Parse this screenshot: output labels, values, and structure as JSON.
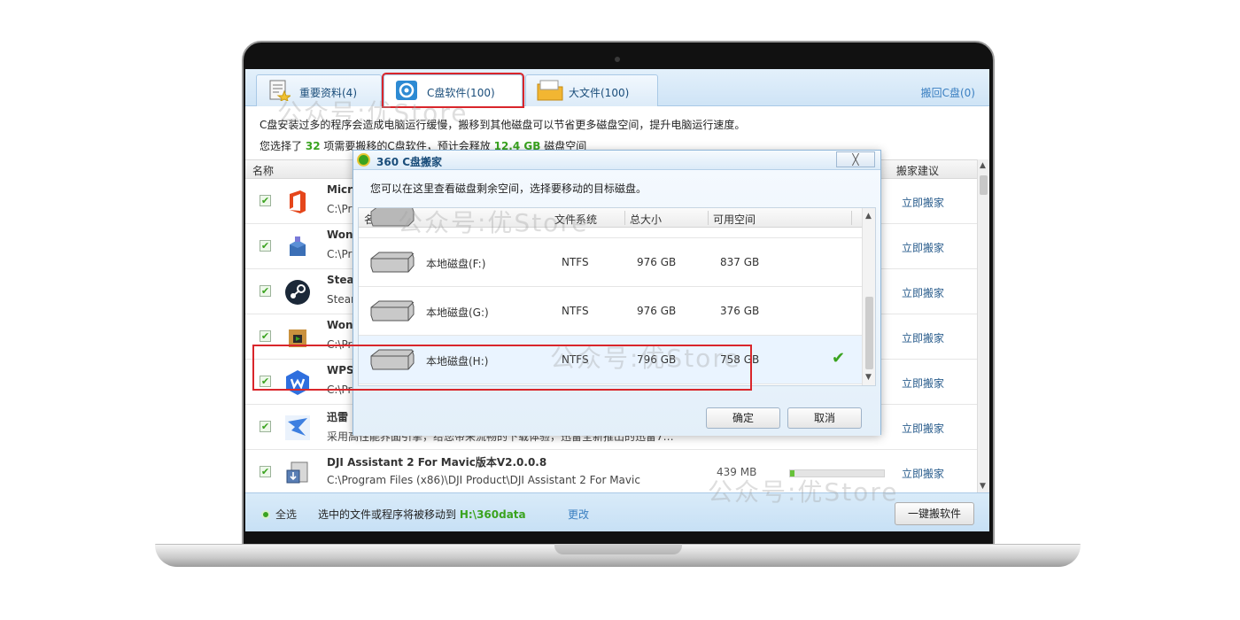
{
  "tabs": [
    {
      "label": "重要资料(4)",
      "icon": "document-star-icon"
    },
    {
      "label": "C盘软件(100)",
      "icon": "disk-c-icon"
    },
    {
      "label": "大文件(100)",
      "icon": "folder-icon"
    }
  ],
  "restore_link": "搬回C盘(0)",
  "description": "C盘安装过多的程序会造成电脑运行缓慢，搬移到其他磁盘可以节省更多磁盘空间，提升电脑运行速度。",
  "summary": {
    "prefix": "您选择了",
    "count": "32",
    "middle": "项需要搬移的C盘软件，预计会释放",
    "size": "12.4 GB",
    "suffix": "磁盘空间"
  },
  "list": {
    "header_name": "名称",
    "header_advice": "搬家建议",
    "rows": [
      {
        "name": "Micro",
        "path": "C:\\Pr",
        "action": "立即搬家",
        "icon": "office-icon"
      },
      {
        "name": "Won",
        "path": "C:\\Pr",
        "action": "立即搬家",
        "icon": "box-icon"
      },
      {
        "name": "Stea",
        "path": "Stear",
        "action": "立即搬家",
        "icon": "steam-icon"
      },
      {
        "name": "Won",
        "path": "C:\\Pr",
        "action": "立即搬家",
        "icon": "package-icon"
      },
      {
        "name": "WPS",
        "path": "C:\\Pr",
        "action": "立即搬家",
        "icon": "wps-icon"
      },
      {
        "name": "迅雷",
        "path": "采用高性能界面引擎，给您带来流畅的下载体验，迅雷全新推出的迅雷7…",
        "action": "立即搬家",
        "icon": "xunlei-icon"
      },
      {
        "name": "DJI Assistant 2 For Mavic版本V2.0.0.8",
        "path": "C:\\Program Files (x86)\\DJI Product\\DJI Assistant 2 For Mavic",
        "size": "439 MB",
        "bar_fraction": 0.05,
        "action": "立即搬家",
        "icon": "installer-icon"
      }
    ]
  },
  "footer": {
    "select_all": "全选",
    "move_prefix": "选中的文件或程序将被移动到",
    "move_path": "H:\\360data",
    "change": "更改",
    "one_key": "一键搬软件"
  },
  "dialog": {
    "title": "360 C盘搬家",
    "close": "╳",
    "description": "您可以在这里查看磁盘剩余空间，选择要移动的目标磁盘。",
    "columns": {
      "name": "名称",
      "fs": "文件系统",
      "total": "总大小",
      "free": "可用空间"
    },
    "drives": [
      {
        "name": "本地磁盘(F:)",
        "fs": "NTFS",
        "total": "976 GB",
        "free": "837 GB",
        "selected": false
      },
      {
        "name": "本地磁盘(G:)",
        "fs": "NTFS",
        "total": "976 GB",
        "free": "376 GB",
        "selected": false
      },
      {
        "name": "本地磁盘(H:)",
        "fs": "NTFS",
        "total": "796 GB",
        "free": "758 GB",
        "selected": true
      }
    ],
    "ok": "确定",
    "cancel": "取消"
  },
  "watermark": "公众号:优Store",
  "colors": {
    "accent_green": "#3aa31f",
    "highlight_red": "#d9262b",
    "link_blue": "#3a7fc1"
  }
}
